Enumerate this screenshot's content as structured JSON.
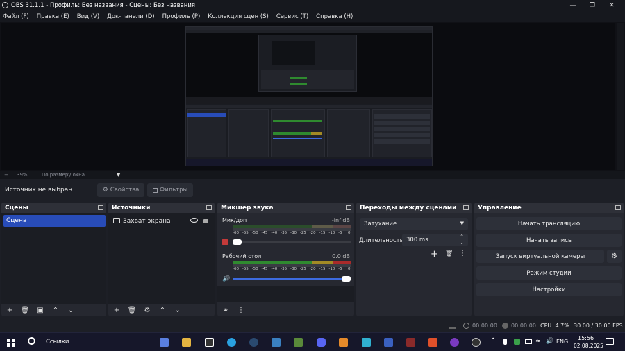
{
  "window": {
    "title": "OBS 31.1.1 - Профиль: Без названия - Сцены: Без названия",
    "minimize_icon": "minimize-icon",
    "maximize_icon": "maximize-icon",
    "close_icon": "close-icon"
  },
  "menu": [
    "Файл (F)",
    "Правка (E)",
    "Вид (V)",
    "Док-панели (D)",
    "Профиль (P)",
    "Коллекция сцен (S)",
    "Сервис (T)",
    "Справка (H)"
  ],
  "preview": {
    "zoom_label": "39%",
    "zoom_minus": "−",
    "fit_label": "По размеру окна"
  },
  "source_toolbar": {
    "no_source": "Источник не выбран",
    "properties": "Свойства",
    "filters": "Фильтры"
  },
  "scenes": {
    "title": "Сцены",
    "items": [
      "Сцена"
    ]
  },
  "sources": {
    "title": "Источники",
    "items": [
      "Захват экрана"
    ]
  },
  "mixer": {
    "title": "Микшер звука",
    "channels": [
      {
        "name": "Мик/доп",
        "db": "-inf dB",
        "level": 0,
        "volume": 0.05,
        "muted": true
      },
      {
        "name": "Рабочий стол",
        "db": "0.0 dB",
        "level": 1.0,
        "volume": 1.0,
        "muted": false
      }
    ],
    "ticks": [
      "-60",
      "-55",
      "-50",
      "-45",
      "-40",
      "-35",
      "-30",
      "-25",
      "-20",
      "-15",
      "-10",
      "-5",
      "0"
    ]
  },
  "transitions": {
    "title": "Переходы между сценами",
    "selected": "Затухание",
    "duration_label": "Длительность",
    "duration_value": "300 ms"
  },
  "controls": {
    "title": "Управление",
    "buttons": [
      "Начать трансляцию",
      "Начать запись",
      "Запуск виртуальной камеры",
      "Режим студии",
      "Настройки"
    ]
  },
  "status": {
    "stream_time": "00:00:00",
    "rec_time": "00:00:00",
    "cpu": "CPU: 4.7%",
    "fps": "30.00 / 30.00 FPS"
  },
  "taskbar": {
    "search_label": "Ссылки",
    "lang": "ENG",
    "time": "15:56",
    "date": "02.08.2025"
  },
  "colors": {
    "accent": "#284cb8",
    "meter_green": "#2f8a2f",
    "meter_yellow": "#a28a25",
    "meter_red": "#a82a2a",
    "muted_red": "#c33a3a"
  }
}
